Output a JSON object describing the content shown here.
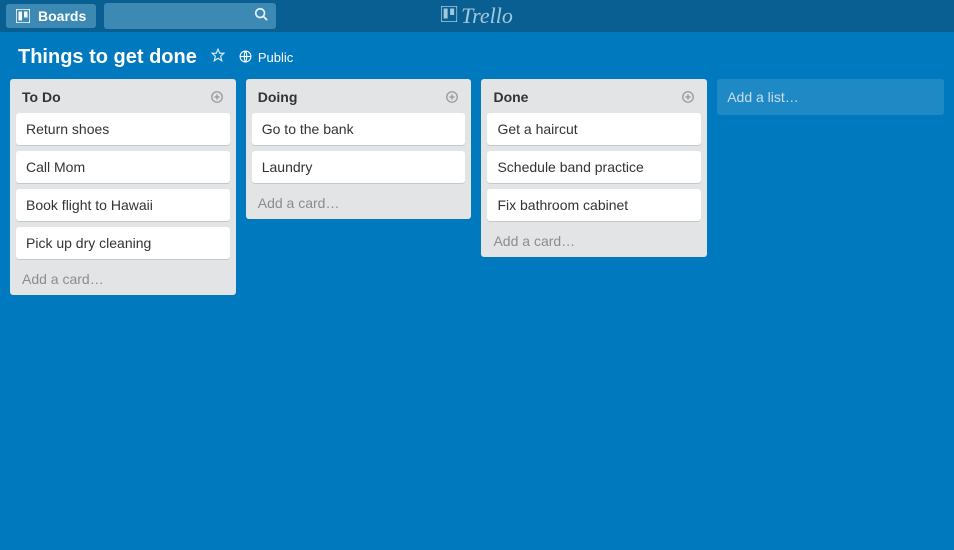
{
  "app": {
    "name": "Trello",
    "boards_button_label": "Boards"
  },
  "board": {
    "title": "Things to get done",
    "visibility_label": "Public",
    "add_list_label": "Add a list…"
  },
  "lists": [
    {
      "name": "To Do",
      "add_card_label": "Add a card…",
      "cards": [
        {
          "title": "Return shoes"
        },
        {
          "title": "Call Mom"
        },
        {
          "title": "Book flight to Hawaii"
        },
        {
          "title": "Pick up dry cleaning"
        }
      ]
    },
    {
      "name": "Doing",
      "add_card_label": "Add a card…",
      "cards": [
        {
          "title": "Go to the bank"
        },
        {
          "title": "Laundry"
        }
      ]
    },
    {
      "name": "Done",
      "add_card_label": "Add a card…",
      "cards": [
        {
          "title": "Get a haircut"
        },
        {
          "title": "Schedule band practice"
        },
        {
          "title": "Fix bathroom cabinet"
        }
      ]
    }
  ]
}
